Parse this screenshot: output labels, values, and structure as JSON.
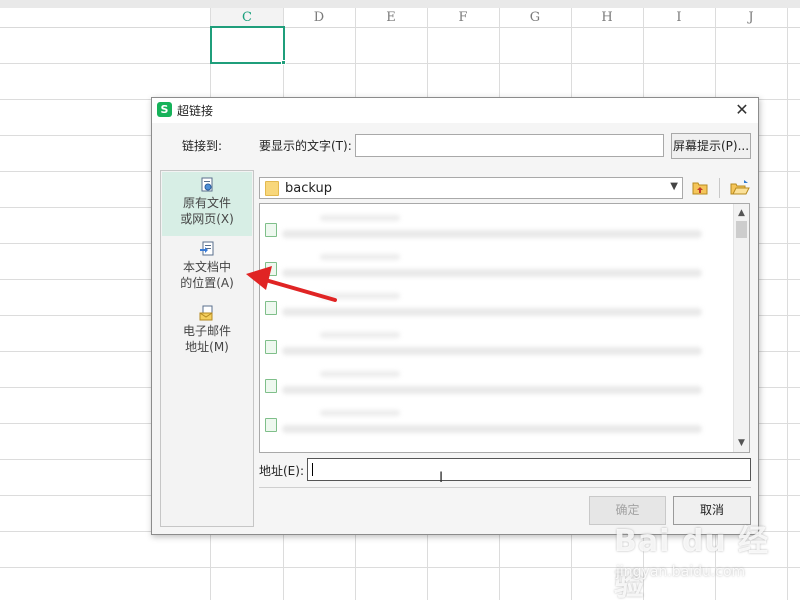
{
  "sheet": {
    "columns": [
      "C",
      "D",
      "E",
      "F",
      "G",
      "H",
      "I",
      "J"
    ]
  },
  "dialog": {
    "title": "超链接",
    "close_glyph": "✕",
    "link_to_label": "链接到:",
    "display_text_label": "要显示的文字(T):",
    "display_text_value": "",
    "screen_tip_button": "屏幕提示(P)...",
    "nav": [
      {
        "line1": "原有文件",
        "line2": "或网页(X)",
        "icon": "file-icon",
        "active": true
      },
      {
        "line1": "本文档中",
        "line2": "的位置(A)",
        "icon": "document-place-icon",
        "active": false
      },
      {
        "line1": "电子邮件",
        "line2": "地址(M)",
        "icon": "email-icon",
        "active": false
      }
    ],
    "folder": "backup",
    "address_label": "地址(E):",
    "address_value": "",
    "ok_button": "确定",
    "cancel_button": "取消"
  },
  "colors": {
    "accent": "#1f9e7b",
    "nav_active": "#d7eee5",
    "arrow": "#e02424",
    "app_logo": "#16b25a"
  },
  "watermark": {
    "logo": "Bai du 经验",
    "url": "jingyan.baidu.com"
  }
}
